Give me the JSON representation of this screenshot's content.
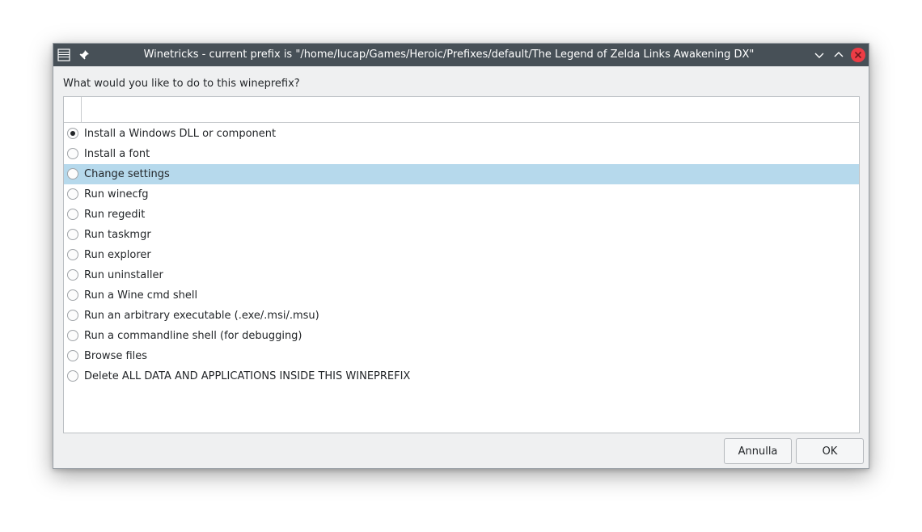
{
  "window": {
    "title": "Winetricks - current prefix is \"/home/lucap/Games/Heroic/Prefixes/default/The Legend of Zelda Links Awakening DX\"",
    "icons": [
      "app-menu-icon",
      "pin-icon"
    ],
    "controls": [
      "minimize-icon",
      "maximize-icon",
      "close-icon"
    ],
    "close_color": "#ed3c45",
    "titlebar_color": "#475057"
  },
  "dialog": {
    "prompt": "What would you like to do to this wineprefix?",
    "selection_color": "#b6d9ec",
    "options": [
      {
        "label": "Install a Windows DLL or component",
        "checked": true,
        "highlighted": false
      },
      {
        "label": "Install a font",
        "checked": false,
        "highlighted": false
      },
      {
        "label": "Change settings",
        "checked": false,
        "highlighted": true
      },
      {
        "label": "Run winecfg",
        "checked": false,
        "highlighted": false
      },
      {
        "label": "Run regedit",
        "checked": false,
        "highlighted": false
      },
      {
        "label": "Run taskmgr",
        "checked": false,
        "highlighted": false
      },
      {
        "label": "Run explorer",
        "checked": false,
        "highlighted": false
      },
      {
        "label": "Run uninstaller",
        "checked": false,
        "highlighted": false
      },
      {
        "label": "Run a Wine cmd shell",
        "checked": false,
        "highlighted": false
      },
      {
        "label": "Run an arbitrary executable (.exe/.msi/.msu)",
        "checked": false,
        "highlighted": false
      },
      {
        "label": "Run a commandline shell (for debugging)",
        "checked": false,
        "highlighted": false
      },
      {
        "label": "Browse files",
        "checked": false,
        "highlighted": false
      },
      {
        "label": "Delete ALL DATA AND APPLICATIONS INSIDE THIS WINEPREFIX",
        "checked": false,
        "highlighted": false
      }
    ]
  },
  "buttons": {
    "cancel_label": "Annulla",
    "ok_label": "OK"
  }
}
